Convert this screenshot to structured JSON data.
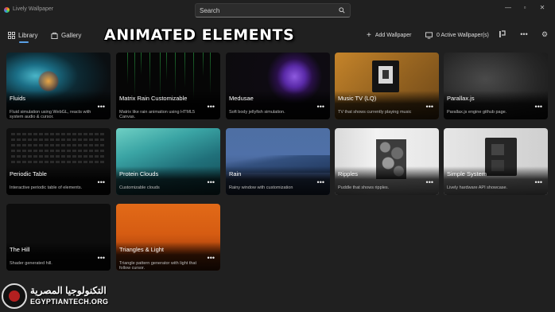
{
  "window": {
    "app_title": "Lively Wallpaper"
  },
  "search": {
    "placeholder": "Search"
  },
  "tabs": [
    {
      "label": "Library",
      "icon": "grid-icon",
      "selected": true
    },
    {
      "label": "Gallery",
      "icon": "bag-icon",
      "selected": false
    }
  ],
  "overlay_title": "ANIMATED ELEMENTS",
  "toolbar": {
    "add_wallpaper": "Add Wallpaper",
    "active_wallpapers": "0 Active Wallpaper(s)"
  },
  "colors": {
    "accent": "#5aa0e6",
    "background": "#202020"
  },
  "wallpapers": [
    {
      "title": "Fluids",
      "description": "Fluid simulation using WebGL, reacts with system audio & cursor."
    },
    {
      "title": "Matrix Rain Customizable",
      "description": "Matrix like rain animation using HTML5 Canvas."
    },
    {
      "title": "Medusae",
      "description": "Soft body jellyfish simulation."
    },
    {
      "title": "Music TV (LQ)",
      "description": "TV that shows currently playing music"
    },
    {
      "title": "Parallax.js",
      "description": "Parallax.js engine github page."
    },
    {
      "title": "Periodic Table",
      "description": "Interactive periodic table of elements."
    },
    {
      "title": "Protein Clouds",
      "description": "Customizable clouds"
    },
    {
      "title": "Rain",
      "description": "Rainy window with customization"
    },
    {
      "title": "Ripples",
      "description": "Puddle that shows ripples."
    },
    {
      "title": "Simple System",
      "description": "Lively hardware API showcase."
    },
    {
      "title": "The Hill",
      "description": "Shader generated hill."
    },
    {
      "title": "Triangles & Light",
      "description": "Triangle pattern generator with light that follow cursor."
    }
  ],
  "more_label": "•••",
  "watermark": {
    "arabic": "التكنولوجيا المصرية",
    "english": "EGYPTIANTECH.ORG"
  }
}
